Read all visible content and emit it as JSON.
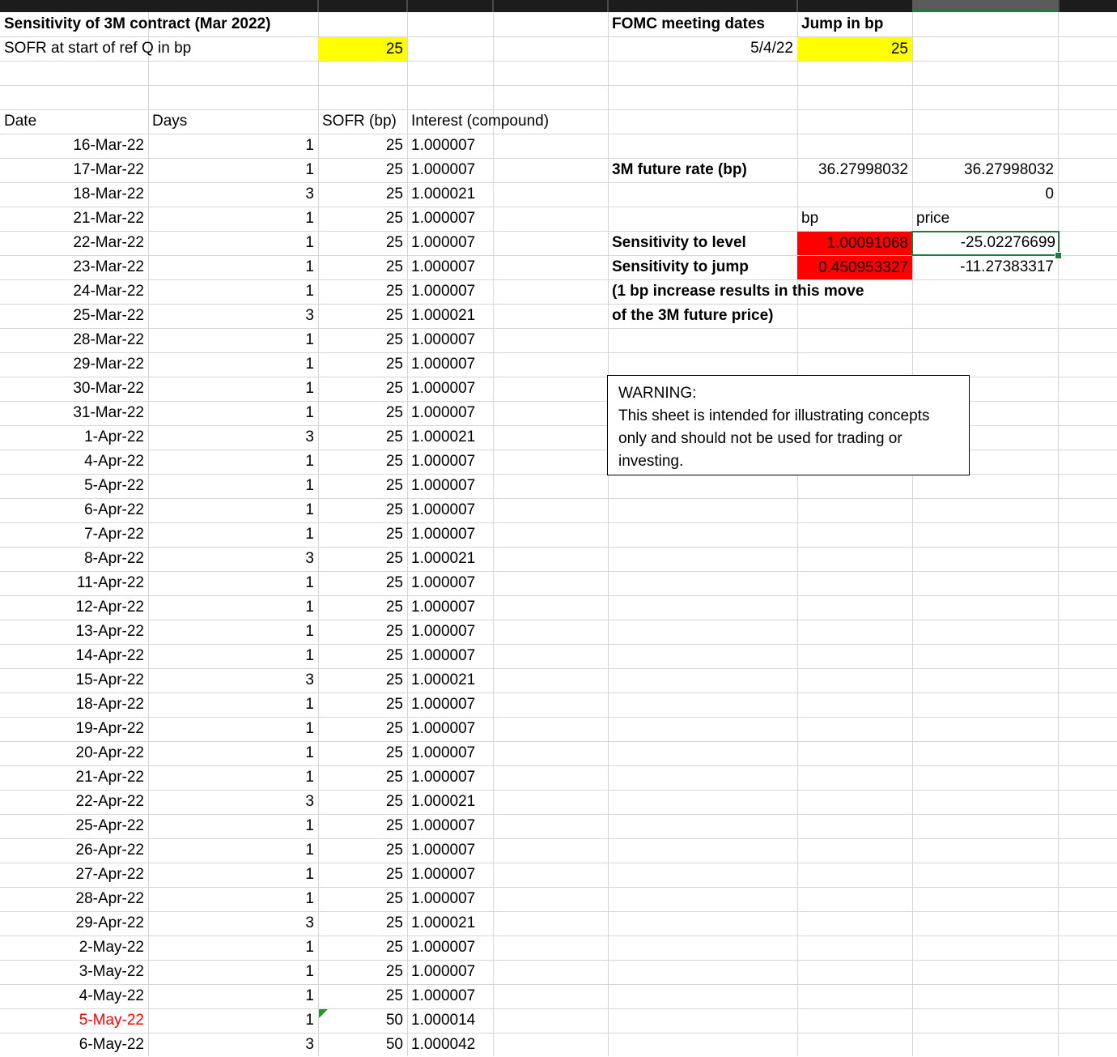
{
  "sheet": {
    "title": "Sensitivity of 3M contract (Mar 2022)",
    "sofr_start_label": "SOFR at start of ref Q in bp",
    "sofr_start_value": "25",
    "fomc_label": "FOMC meeting dates",
    "jump_label": "Jump in bp",
    "fomc_date": "5/4/22",
    "jump_value": "25"
  },
  "columns": {
    "date": "Date",
    "days": "Days",
    "sofr": "SOFR (bp)",
    "interest": "Interest (compound)"
  },
  "rows": [
    {
      "date": "16-Mar-22",
      "days": "1",
      "sofr": "25",
      "interest": "1.000007"
    },
    {
      "date": "17-Mar-22",
      "days": "1",
      "sofr": "25",
      "interest": "1.000007"
    },
    {
      "date": "18-Mar-22",
      "days": "3",
      "sofr": "25",
      "interest": "1.000021"
    },
    {
      "date": "21-Mar-22",
      "days": "1",
      "sofr": "25",
      "interest": "1.000007"
    },
    {
      "date": "22-Mar-22",
      "days": "1",
      "sofr": "25",
      "interest": "1.000007"
    },
    {
      "date": "23-Mar-22",
      "days": "1",
      "sofr": "25",
      "interest": "1.000007"
    },
    {
      "date": "24-Mar-22",
      "days": "1",
      "sofr": "25",
      "interest": "1.000007"
    },
    {
      "date": "25-Mar-22",
      "days": "3",
      "sofr": "25",
      "interest": "1.000021"
    },
    {
      "date": "28-Mar-22",
      "days": "1",
      "sofr": "25",
      "interest": "1.000007"
    },
    {
      "date": "29-Mar-22",
      "days": "1",
      "sofr": "25",
      "interest": "1.000007"
    },
    {
      "date": "30-Mar-22",
      "days": "1",
      "sofr": "25",
      "interest": "1.000007"
    },
    {
      "date": "31-Mar-22",
      "days": "1",
      "sofr": "25",
      "interest": "1.000007"
    },
    {
      "date": "1-Apr-22",
      "days": "3",
      "sofr": "25",
      "interest": "1.000021"
    },
    {
      "date": "4-Apr-22",
      "days": "1",
      "sofr": "25",
      "interest": "1.000007"
    },
    {
      "date": "5-Apr-22",
      "days": "1",
      "sofr": "25",
      "interest": "1.000007"
    },
    {
      "date": "6-Apr-22",
      "days": "1",
      "sofr": "25",
      "interest": "1.000007"
    },
    {
      "date": "7-Apr-22",
      "days": "1",
      "sofr": "25",
      "interest": "1.000007"
    },
    {
      "date": "8-Apr-22",
      "days": "3",
      "sofr": "25",
      "interest": "1.000021"
    },
    {
      "date": "11-Apr-22",
      "days": "1",
      "sofr": "25",
      "interest": "1.000007"
    },
    {
      "date": "12-Apr-22",
      "days": "1",
      "sofr": "25",
      "interest": "1.000007"
    },
    {
      "date": "13-Apr-22",
      "days": "1",
      "sofr": "25",
      "interest": "1.000007"
    },
    {
      "date": "14-Apr-22",
      "days": "1",
      "sofr": "25",
      "interest": "1.000007"
    },
    {
      "date": "15-Apr-22",
      "days": "3",
      "sofr": "25",
      "interest": "1.000021"
    },
    {
      "date": "18-Apr-22",
      "days": "1",
      "sofr": "25",
      "interest": "1.000007"
    },
    {
      "date": "19-Apr-22",
      "days": "1",
      "sofr": "25",
      "interest": "1.000007"
    },
    {
      "date": "20-Apr-22",
      "days": "1",
      "sofr": "25",
      "interest": "1.000007"
    },
    {
      "date": "21-Apr-22",
      "days": "1",
      "sofr": "25",
      "interest": "1.000007"
    },
    {
      "date": "22-Apr-22",
      "days": "3",
      "sofr": "25",
      "interest": "1.000021"
    },
    {
      "date": "25-Apr-22",
      "days": "1",
      "sofr": "25",
      "interest": "1.000007"
    },
    {
      "date": "26-Apr-22",
      "days": "1",
      "sofr": "25",
      "interest": "1.000007"
    },
    {
      "date": "27-Apr-22",
      "days": "1",
      "sofr": "25",
      "interest": "1.000007"
    },
    {
      "date": "28-Apr-22",
      "days": "1",
      "sofr": "25",
      "interest": "1.000007"
    },
    {
      "date": "29-Apr-22",
      "days": "3",
      "sofr": "25",
      "interest": "1.000021"
    },
    {
      "date": "2-May-22",
      "days": "1",
      "sofr": "25",
      "interest": "1.000007"
    },
    {
      "date": "3-May-22",
      "days": "1",
      "sofr": "25",
      "interest": "1.000007"
    },
    {
      "date": "4-May-22",
      "days": "1",
      "sofr": "25",
      "interest": "1.000007"
    },
    {
      "date": "5-May-22",
      "days": "1",
      "sofr": "50",
      "interest": "1.000014",
      "highlight": true
    },
    {
      "date": "6-May-22",
      "days": "3",
      "sofr": "50",
      "interest": "1.000042"
    }
  ],
  "results": {
    "future_rate_label": "3M future rate (bp)",
    "future_rate_value": "36.27998032",
    "future_rate_value2": "36.27998032",
    "zero_value": "0",
    "bp_header": "bp",
    "price_header": "price",
    "level_label": "Sensitivity to level",
    "level_bp": "1.00091068",
    "level_price": "-25.02276699",
    "jump_label": "Sensitivity to jump",
    "jump_bp": "0.450953327",
    "jump_price": "-11.27383317",
    "note_line1": "(1 bp increase results in this move",
    "note_line2": "of the 3M future price)"
  },
  "warning": {
    "line1": "WARNING:",
    "line2": "This sheet is intended for illustrating concepts",
    "line3": "only and should not be used for trading or",
    "line4": "investing."
  },
  "colors": {
    "input_fill": "#ffff00",
    "sensitivity_fill": "#ff0000",
    "selection": "#1f7a43"
  }
}
